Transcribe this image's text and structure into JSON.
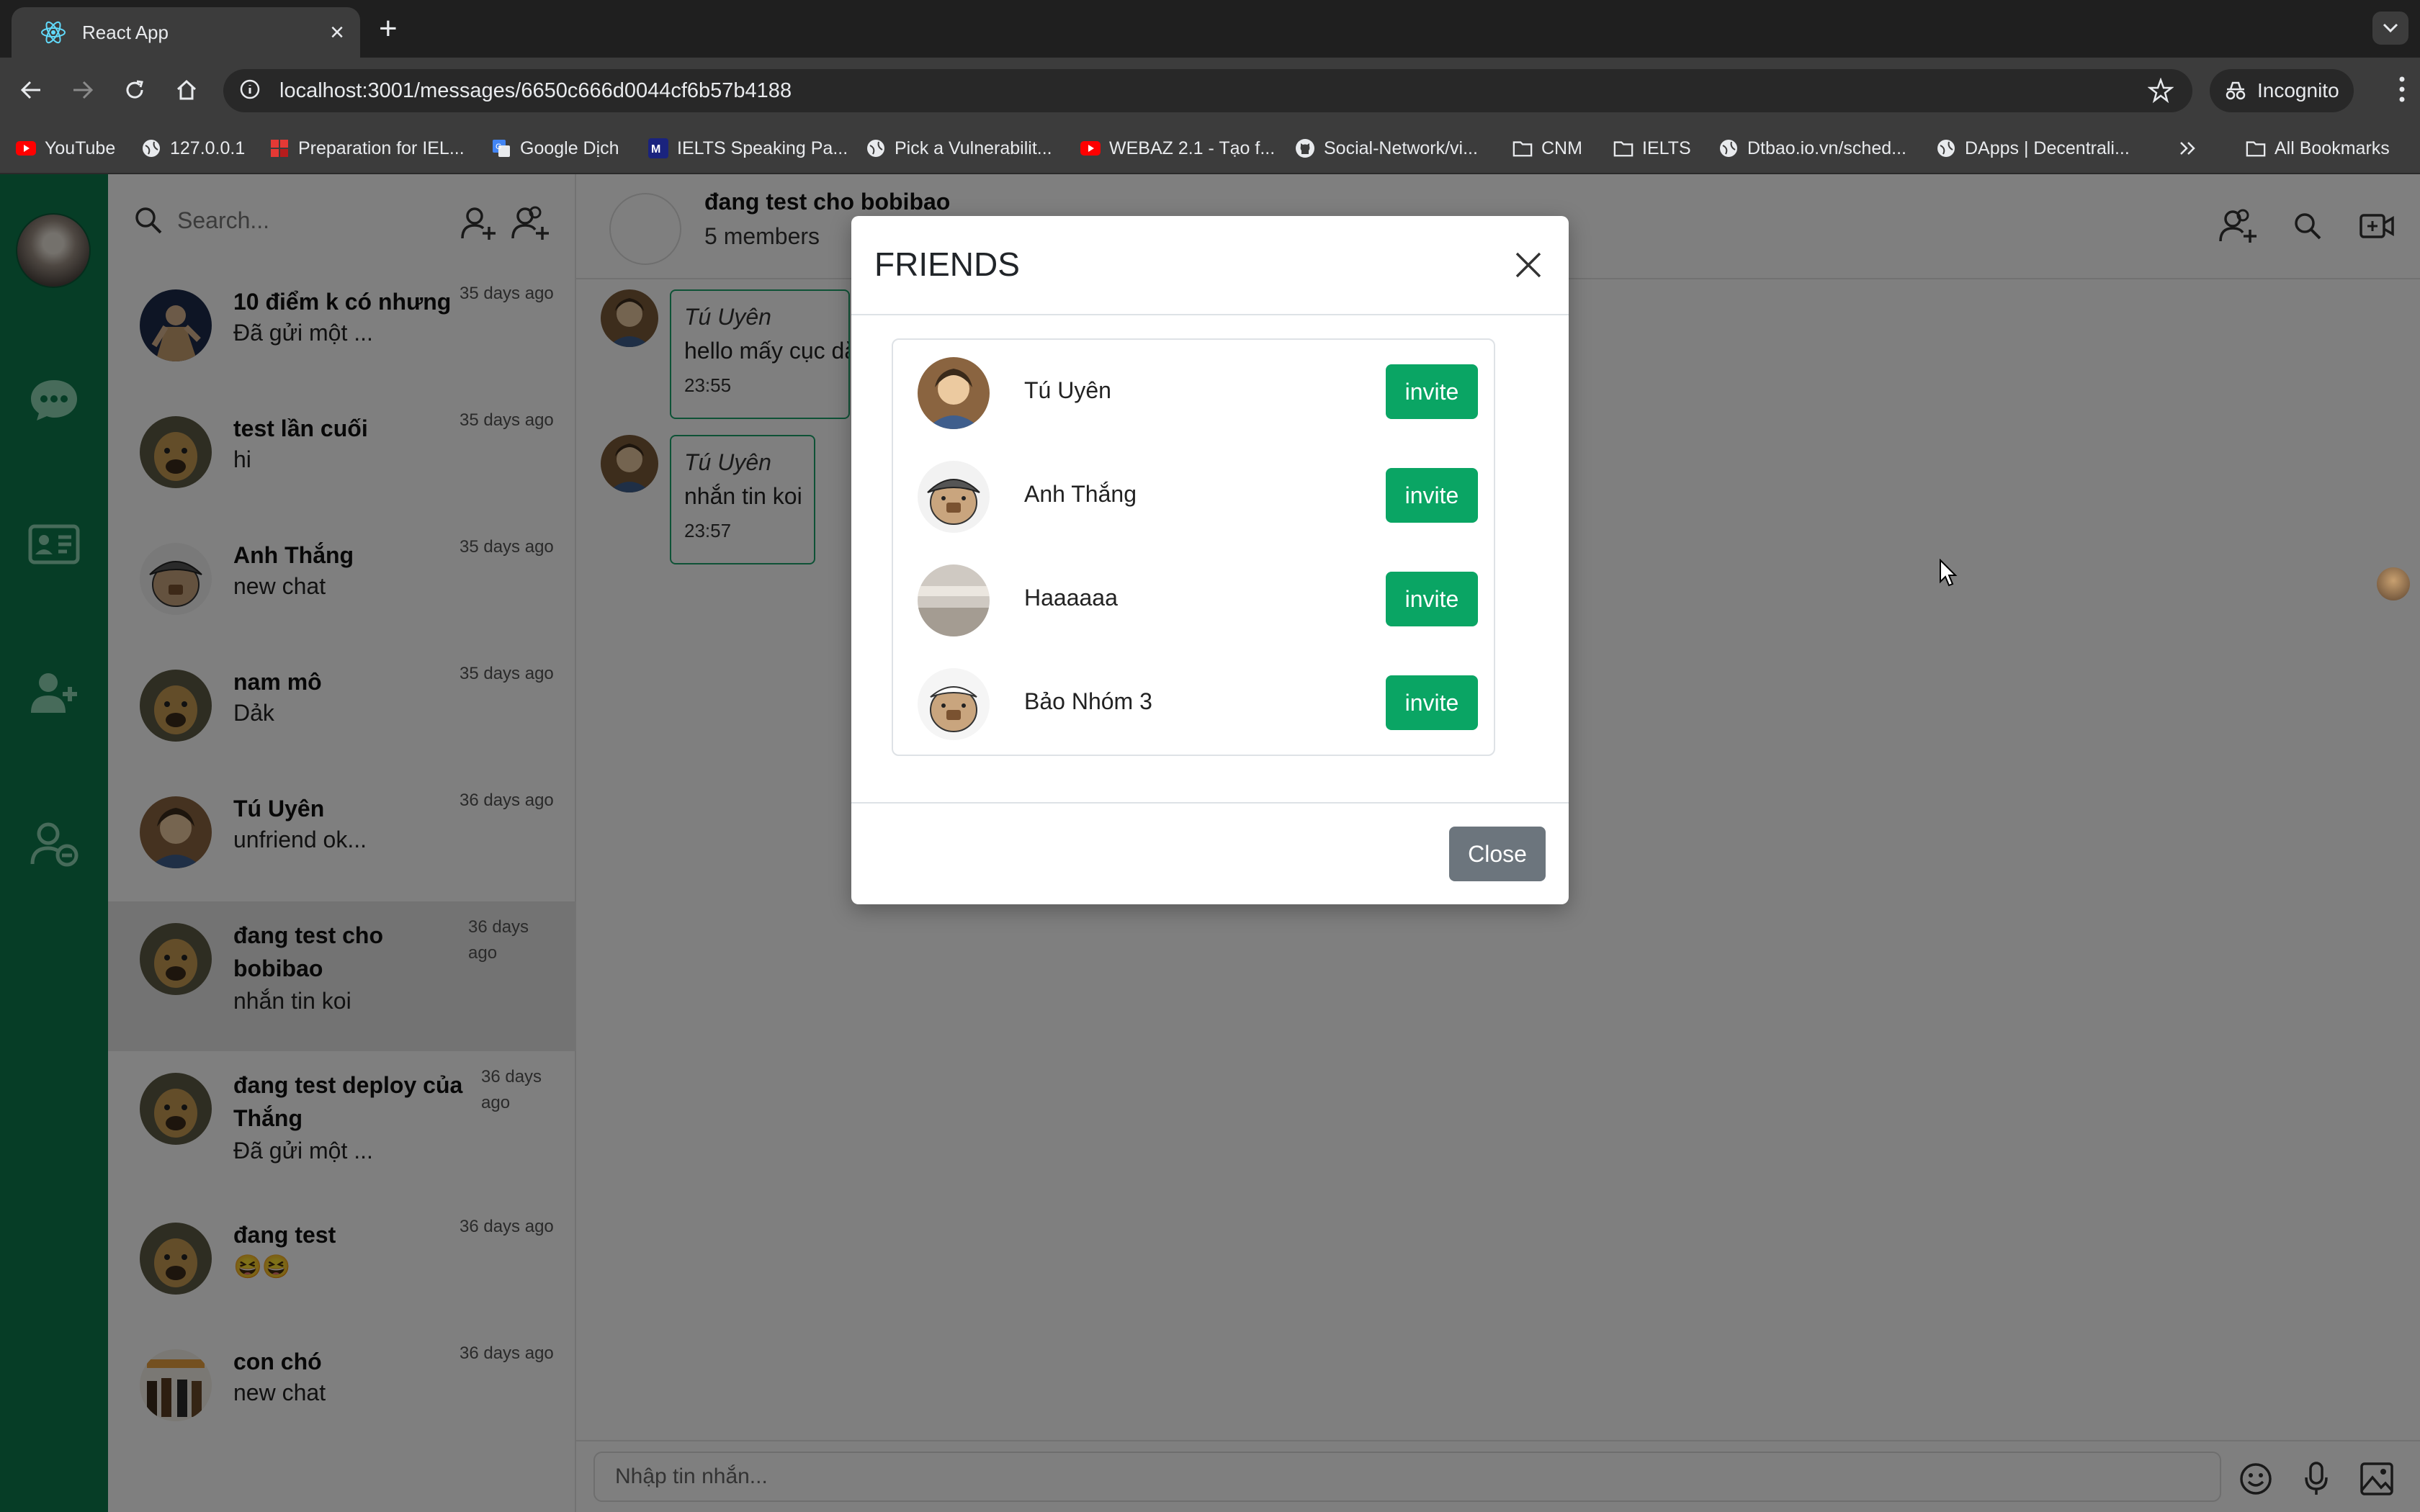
{
  "browser": {
    "tab_title": "React App",
    "url": "localhost:3001/messages/6650c666d0044cf6b57b4188",
    "incognito_label": "Incognito",
    "bookmarks": [
      {
        "label": "YouTube",
        "icon": "youtube-icon"
      },
      {
        "label": "127.0.0.1",
        "icon": "globe-icon"
      },
      {
        "label": "Preparation for IEL...",
        "icon": "red-square-icon"
      },
      {
        "label": "Google Dịch",
        "icon": "google-translate-icon"
      },
      {
        "label": "IELTS Speaking Pa...",
        "icon": "m-logo-icon"
      },
      {
        "label": "Pick a Vulnerabilit...",
        "icon": "globe-icon"
      },
      {
        "label": "WEBAZ 2.1 - Tạo f...",
        "icon": "youtube-icon"
      },
      {
        "label": "Social-Network/vi...",
        "icon": "github-icon"
      },
      {
        "label": "CNM",
        "icon": "folder-icon"
      },
      {
        "label": "IELTS",
        "icon": "folder-icon"
      },
      {
        "label": "Dtbao.io.vn/sched...",
        "icon": "globe-icon"
      },
      {
        "label": "DApps | Decentrali...",
        "icon": "globe-icon"
      }
    ],
    "all_bookmarks_label": "All Bookmarks"
  },
  "sidebar": {
    "search_placeholder": "Search...",
    "conversations": [
      {
        "name": "10 điểm k có nhưng",
        "preview": "Đã gửi một ...",
        "time": "35 days ago"
      },
      {
        "name": "test lần cuối",
        "preview": "hi",
        "time": "35 days ago"
      },
      {
        "name": "Anh Thắng",
        "preview": "new chat",
        "time": "35 days ago"
      },
      {
        "name": "nam mô",
        "preview": "Dảk",
        "time": "35 days ago"
      },
      {
        "name": "Tú Uyên",
        "preview": "unfriend ok...",
        "time": "36 days ago"
      },
      {
        "name": "đang test cho bobibao",
        "preview": "nhắn tin koi",
        "time": "36 days ago"
      },
      {
        "name": "đang test deploy của Thắng",
        "preview": "Đã gửi một ...",
        "time": "36 days ago"
      },
      {
        "name": "đang test",
        "preview": "😆😆",
        "time": "36 days ago"
      },
      {
        "name": "con chó",
        "preview": "new chat",
        "time": "36 days ago"
      }
    ]
  },
  "chat": {
    "group_name": "đang test cho bobibao",
    "members": "5 members",
    "messages": [
      {
        "sender": "Tú Uyên",
        "text": "hello mấy cục dă",
        "time": "23:55"
      },
      {
        "sender": "Tú Uyên",
        "text": "nhắn tin koi",
        "time": "23:57"
      }
    ],
    "composer_placeholder": "Nhập tin nhắn..."
  },
  "modal": {
    "title": "FRIENDS",
    "friends": [
      {
        "name": "Tú Uyên",
        "action": "invite"
      },
      {
        "name": "Anh Thắng",
        "action": "invite"
      },
      {
        "name": "Haaaaaa",
        "action": "invite"
      },
      {
        "name": "Bảo Nhóm 3",
        "action": "invite"
      }
    ],
    "close_label": "Close"
  },
  "colors": {
    "rail": "#0d7a4d",
    "accent_green": "#0aa564",
    "bubble_border": "#1ca56c",
    "close_button": "#6c757d"
  }
}
